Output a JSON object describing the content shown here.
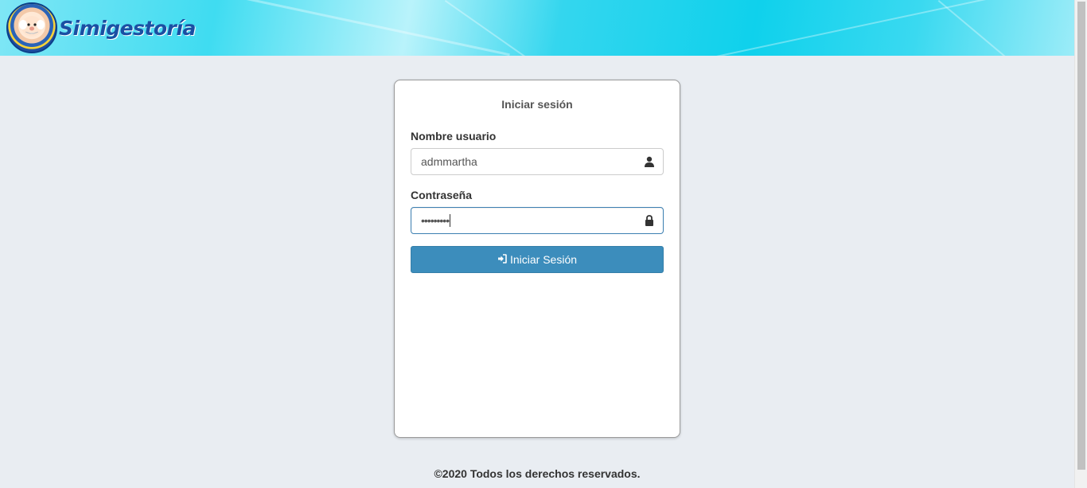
{
  "brand": {
    "name": "Simigestoría",
    "logo_icon": "doctor-simi-logo-icon"
  },
  "login": {
    "title": "Iniciar sesión",
    "username_label": "Nombre usuario",
    "username_value": "admmartha",
    "password_label": "Contraseña",
    "password_value": "•••••••••",
    "submit_label": "Iniciar Sesión",
    "submit_icon": "sign-in-icon",
    "user_icon": "user-icon",
    "lock_icon": "lock-icon"
  },
  "footer": {
    "text": "©2020 Todos los derechos reservados."
  },
  "colors": {
    "accent": "#3c8dbc",
    "header": "#0fd1ec",
    "background": "#e9edf2"
  }
}
